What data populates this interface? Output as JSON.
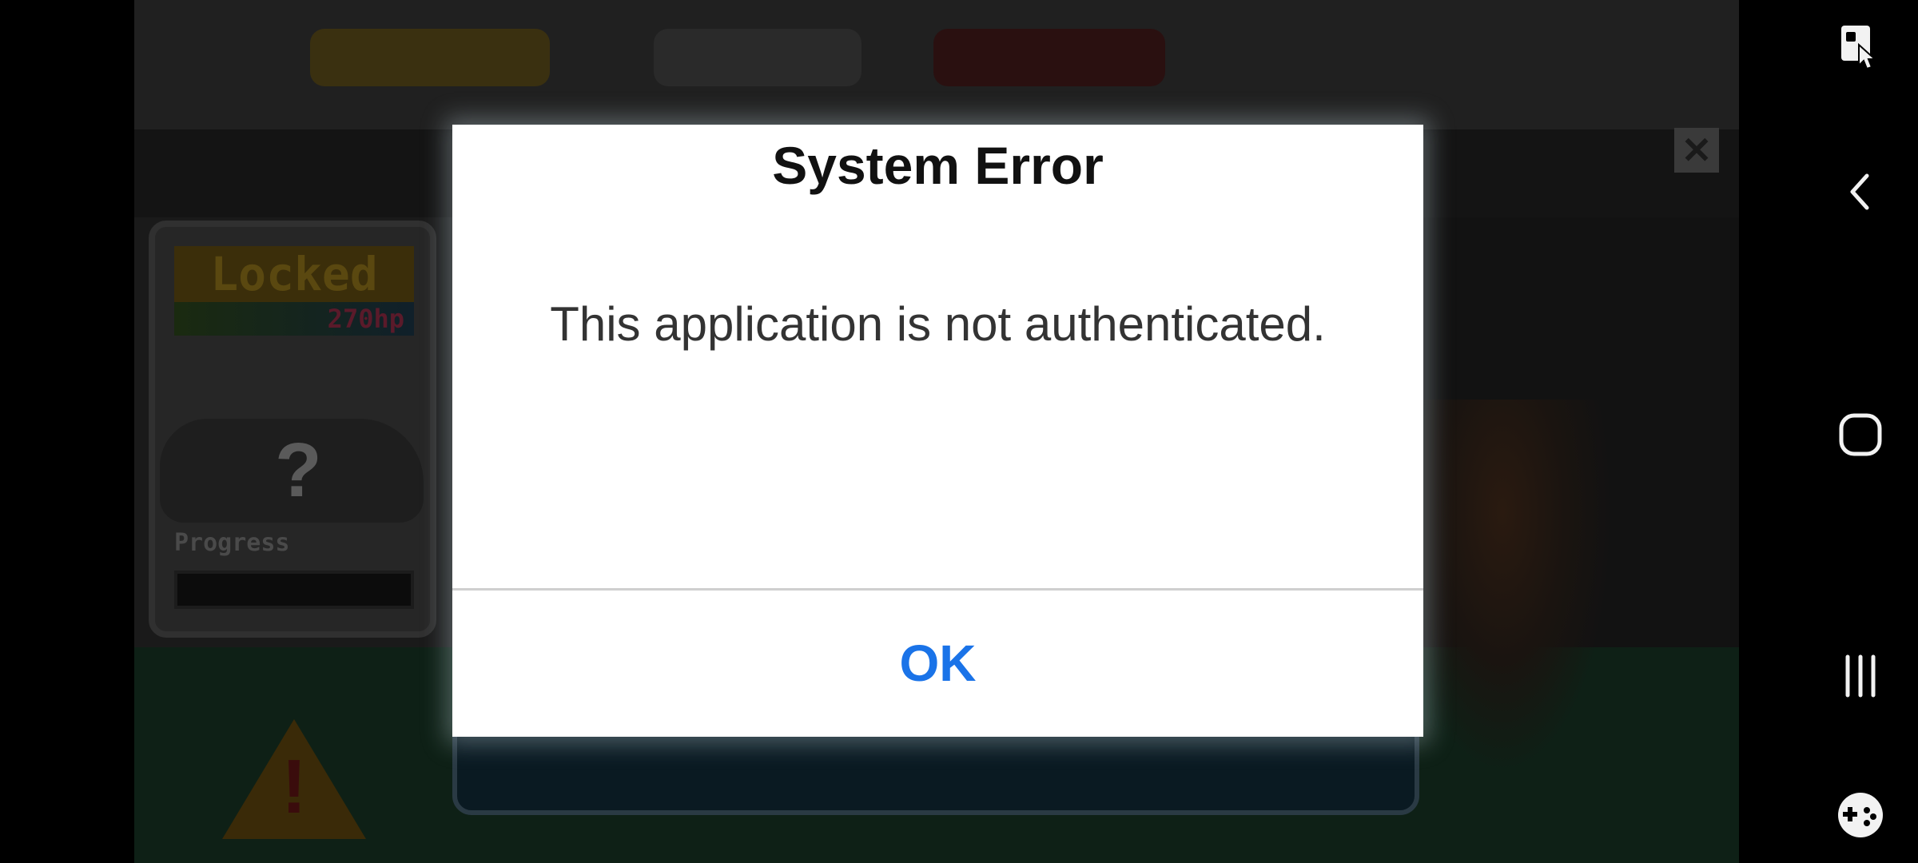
{
  "game": {
    "topbar": {
      "pills": [
        "",
        "",
        ""
      ]
    },
    "card": {
      "title": "Locked",
      "hp": "270hp",
      "mystery": "?",
      "progress_label": "Progress"
    },
    "close_symbol": "✕",
    "warning_mark": "!"
  },
  "dialog": {
    "title": "System Error",
    "message": "This application is not authenticated.",
    "ok_label": "OK"
  },
  "navbar": {
    "icons": [
      "screen-touch-icon",
      "back-icon",
      "home-icon",
      "recents-icon",
      "game-tools-icon"
    ]
  },
  "colors": {
    "ok_text": "#1a73e8",
    "dialog_bg": "#ffffff",
    "nav_icon": "#f2f2f2"
  }
}
